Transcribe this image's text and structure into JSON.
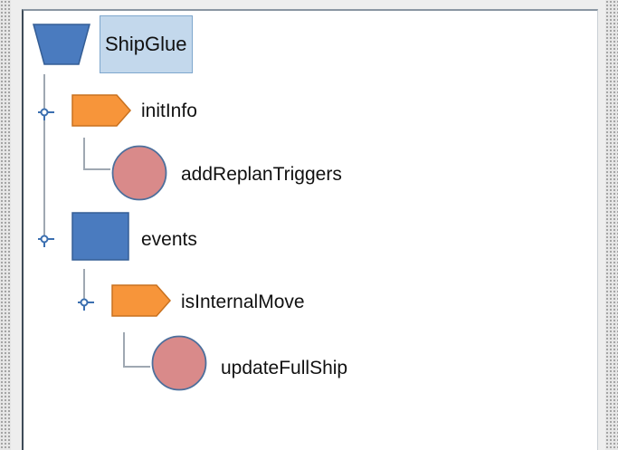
{
  "tree": {
    "root": {
      "label": "ShipGlue",
      "icon": "trapezoid-icon",
      "selected": true
    },
    "nodes": [
      {
        "label": "initInfo",
        "icon": "tag-icon",
        "color": "#f7953a"
      },
      {
        "label": "addReplanTriggers",
        "icon": "circle-icon",
        "color": "#d98a8a"
      },
      {
        "label": "events",
        "icon": "square-icon",
        "color": "#4a7bbf"
      },
      {
        "label": "isInternalMove",
        "icon": "tag-icon",
        "color": "#f7953a"
      },
      {
        "label": "updateFullShip",
        "icon": "circle-icon",
        "color": "#d98a8a"
      }
    ]
  },
  "colors": {
    "selection": "#c3d8ec",
    "connector": "#9fa8b2",
    "expand_handle": "#3b6fb0"
  }
}
